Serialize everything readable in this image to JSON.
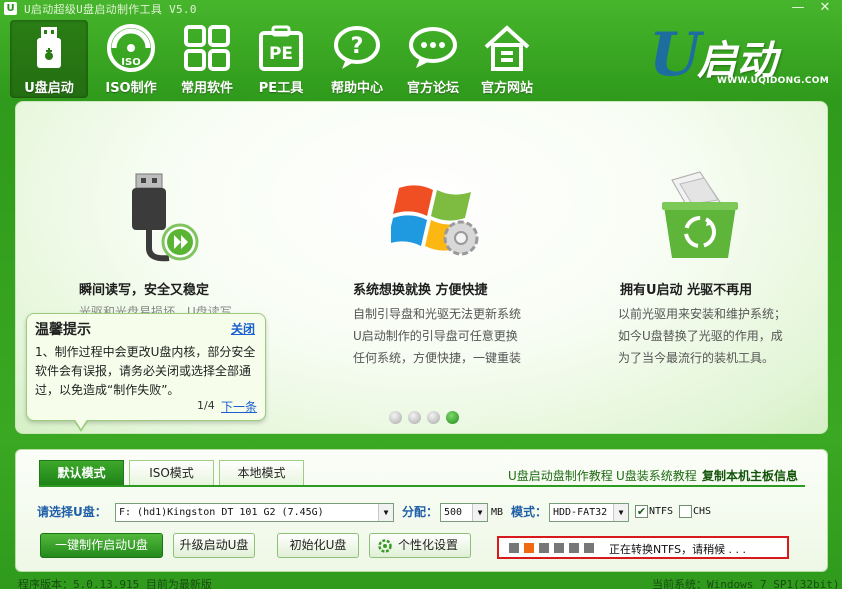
{
  "window": {
    "title": "U启动超级U盘启动制作工具 V5.0",
    "minimize": "—",
    "close": "✕"
  },
  "toolbar": [
    {
      "label": "U盘启动",
      "icon": "usb-drive-icon",
      "active": true
    },
    {
      "label": "ISO制作",
      "icon": "iso-disc-icon",
      "active": false
    },
    {
      "label": "常用软件",
      "icon": "grid-apps-icon",
      "active": false
    },
    {
      "label": "PE工具",
      "icon": "pe-tools-icon",
      "active": false
    },
    {
      "label": "帮助中心",
      "icon": "help-question-icon",
      "active": false
    },
    {
      "label": "官方论坛",
      "icon": "forum-chat-icon",
      "active": false
    },
    {
      "label": "官方网站",
      "icon": "home-website-icon",
      "active": false
    }
  ],
  "logo": {
    "text": "U启动",
    "site": "WWW.UQIDONG.COM"
  },
  "slides": {
    "features": [
      {
        "icon": "usb-cable-icon",
        "title": "瞬间读写，安全又稳定",
        "desc": [
          "光驱和光盘易损坏，U盘读写"
        ]
      },
      {
        "icon": "windows-gear-icon",
        "title": "系统想换就换 方便快捷",
        "desc": [
          "自制引导盘和光驱无法更新系统",
          "U启动制作的引导盘可任意更换",
          "任何系统，方便快捷，一键重装"
        ]
      },
      {
        "icon": "recycle-bin-icon",
        "title": "拥有U启动 光驱不再用",
        "desc": [
          "以前光驱用来安装和维护系统；",
          "如今U盘替换了光驱的作用，成",
          "为了当今最流行的装机工具。"
        ]
      }
    ],
    "dots": 4,
    "active_dot": 4
  },
  "tip": {
    "title": "温馨提示",
    "close": "关闭",
    "body": "1、制作过程中会更改U盘内核，部分安全软件会有误报，请务必关闭或选择全部通过，以免造成“制作失败”。",
    "page": "1/4",
    "next": "下一条"
  },
  "bottom": {
    "tabs": [
      {
        "label": "默认模式",
        "active": true
      },
      {
        "label": "ISO模式",
        "active": false
      },
      {
        "label": "本地模式",
        "active": false
      }
    ],
    "links": {
      "tutorial": "U盘启动盘制作教程",
      "install": "U盘装系统教程",
      "copy": "复制本机主板信息"
    },
    "select_label": "请选择U盘：",
    "drive": "F: (hd1)Kingston DT 101 G2 (7.45G)",
    "alloc_label": "分配：",
    "alloc_value": "500",
    "alloc_unit": "MB",
    "mode_label": "模式：",
    "mode_value": "HDD-FAT32",
    "ntfs_label": "NTFS",
    "ntfs_checked": true,
    "chs_label": "CHS",
    "chs_checked": false,
    "buttons": {
      "make": "一键制作启动U盘",
      "upgrade": "升级启动U盘",
      "init": "初始化U盘",
      "settings": "个性化设置"
    },
    "progress": {
      "total_blocks": 7,
      "active_block": 2,
      "text": "正在转换NTFS，请稍候 . . ."
    }
  },
  "status": {
    "version": "程序版本：5.0.13.915 目前为最新版",
    "system": "当前系统：Windows 7 SP1(32bit)"
  }
}
